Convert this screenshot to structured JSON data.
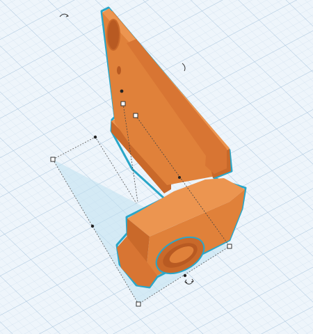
{
  "app": {
    "view": "3d-workplane"
  },
  "colors": {
    "workplane_bg": "#eef5fb",
    "grid_minor": "#cfe0ee",
    "grid_major": "#a9c5dd",
    "part_front": "#e0813a",
    "part_side": "#c9692a",
    "part_top": "#ec9550",
    "part_dark": "#b85a22",
    "selection_outline": "#2aa6c8",
    "footprint_fill": "#bfe0f0",
    "handle_fill": "#ffffff",
    "handle_stroke": "#333333",
    "dim_dot": "#222222"
  },
  "icons": {
    "rotate_top_left": "rotate-arrow-icon",
    "rotate_top_right": "rotate-arrow-icon",
    "rotate_bottom": "rotate-arrow-icon",
    "hole_top": "hole-icon",
    "hole_bottom": "ring-hole-icon"
  }
}
